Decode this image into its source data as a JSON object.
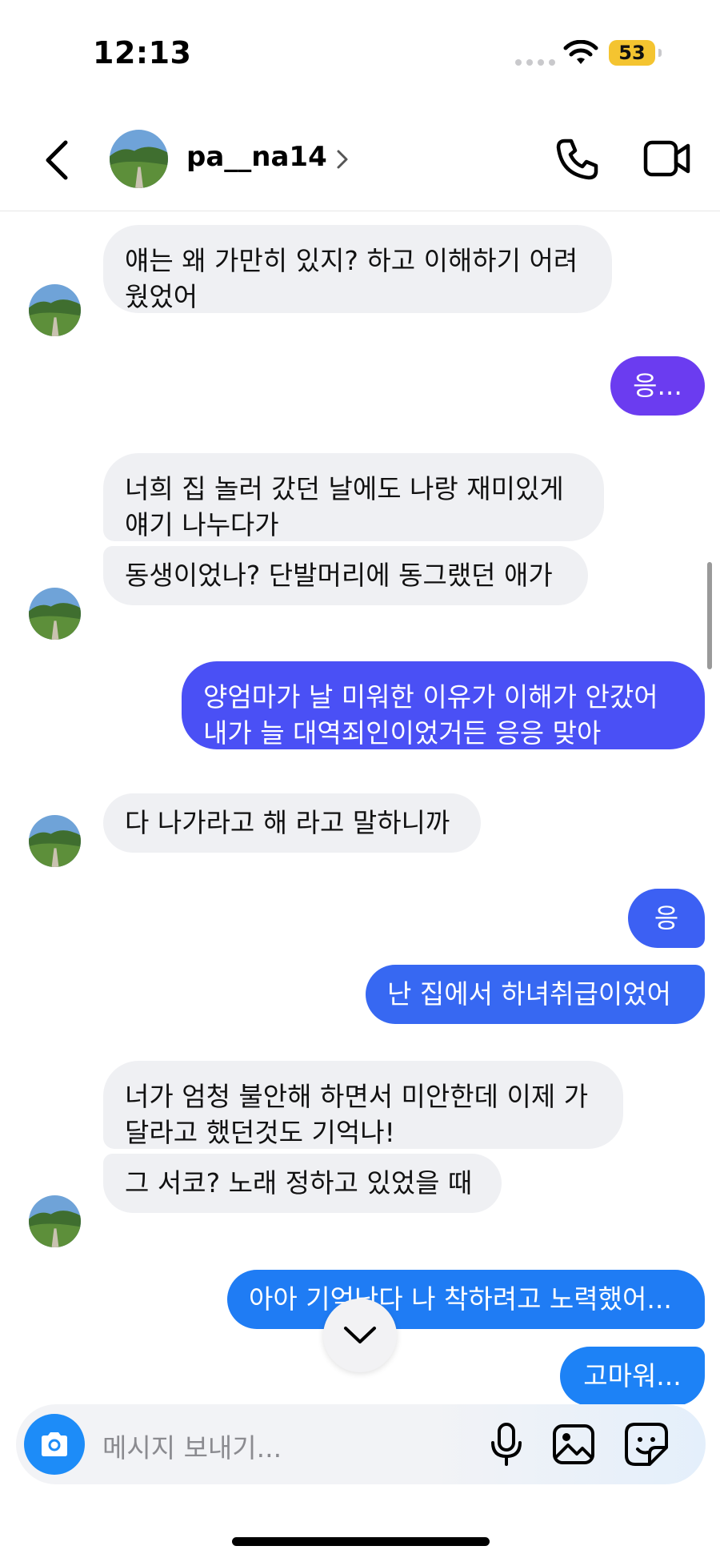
{
  "status_bar": {
    "time": "12:13",
    "battery": "53"
  },
  "header": {
    "username": "pa__na14"
  },
  "messages": [
    {
      "text": "얘는 왜 가만히 있지? 하고 이해하기 어려웠었어"
    },
    {
      "text": "응..."
    },
    {
      "text": "너희 집 놀러 갔던 날에도 나랑 재미있게 얘기 나누다가"
    },
    {
      "text": "동생이었나? 단발머리에 동그랬던 애가"
    },
    {
      "text": "양엄마가 날 미워한 이유가 이해가 안갔어 내가 늘 대역죄인이었거든 응응 맞아"
    },
    {
      "text": "다 나가라고 해 라고 말하니까"
    },
    {
      "text": "응"
    },
    {
      "text": "난 집에서 하녀취급이었어"
    },
    {
      "text": "너가 엄청 불안해 하면서 미안한데 이제 가달라고 했던것도 기억나!"
    },
    {
      "text": "그 서코? 노래 정하고 있었을 때"
    },
    {
      "text": "아아 기억난다 나 착하려고 노력했어..."
    },
    {
      "text": "고마워..."
    }
  ],
  "composer": {
    "placeholder": "메시지 보내기..."
  },
  "icons": [
    "back-icon",
    "chevron-right-icon",
    "phone-icon",
    "video-call-icon",
    "camera-icon",
    "microphone-icon",
    "image-icon",
    "sticker-icon",
    "chevron-down-icon"
  ],
  "colors": {
    "incoming": "#eff0f3",
    "outgoing_purple": "#6b3cf0",
    "outgoing_indigo": "#4a50f5",
    "outgoing_blue": "#3768f2",
    "camera": "#1d8cf8"
  }
}
